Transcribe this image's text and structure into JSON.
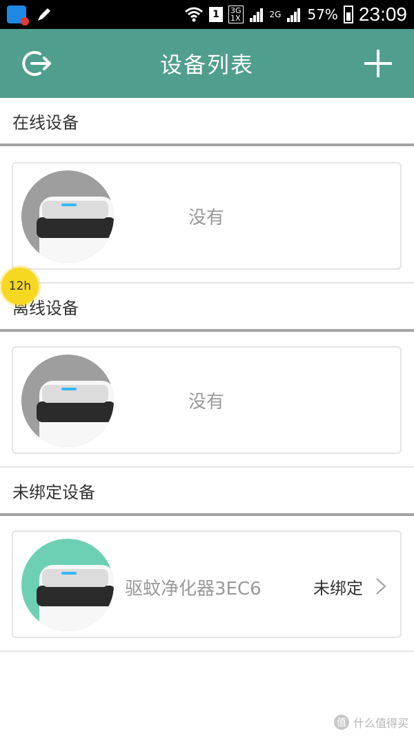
{
  "status_bar": {
    "sim": "1",
    "net_top": "3G",
    "net_bottom": "1X",
    "net_2g": "2G",
    "battery": "57%",
    "time": "23:09"
  },
  "header": {
    "title": "设备列表"
  },
  "sections": {
    "online": {
      "title": "在线设备",
      "empty_text": "没有"
    },
    "offline": {
      "title": "离线设备",
      "empty_text": "没有"
    },
    "unbound": {
      "title": "未绑定设备",
      "device_name": "驱蚊净化器3EC6",
      "status": "未绑定"
    }
  },
  "floating_bubble": {
    "label": "12h"
  },
  "watermark": {
    "icon_glyph": "值",
    "text": "什么值得买"
  },
  "colors": {
    "header": "#509e8e",
    "avatar_grey": "#9e9e9e",
    "avatar_teal": "#6dd0b4"
  }
}
